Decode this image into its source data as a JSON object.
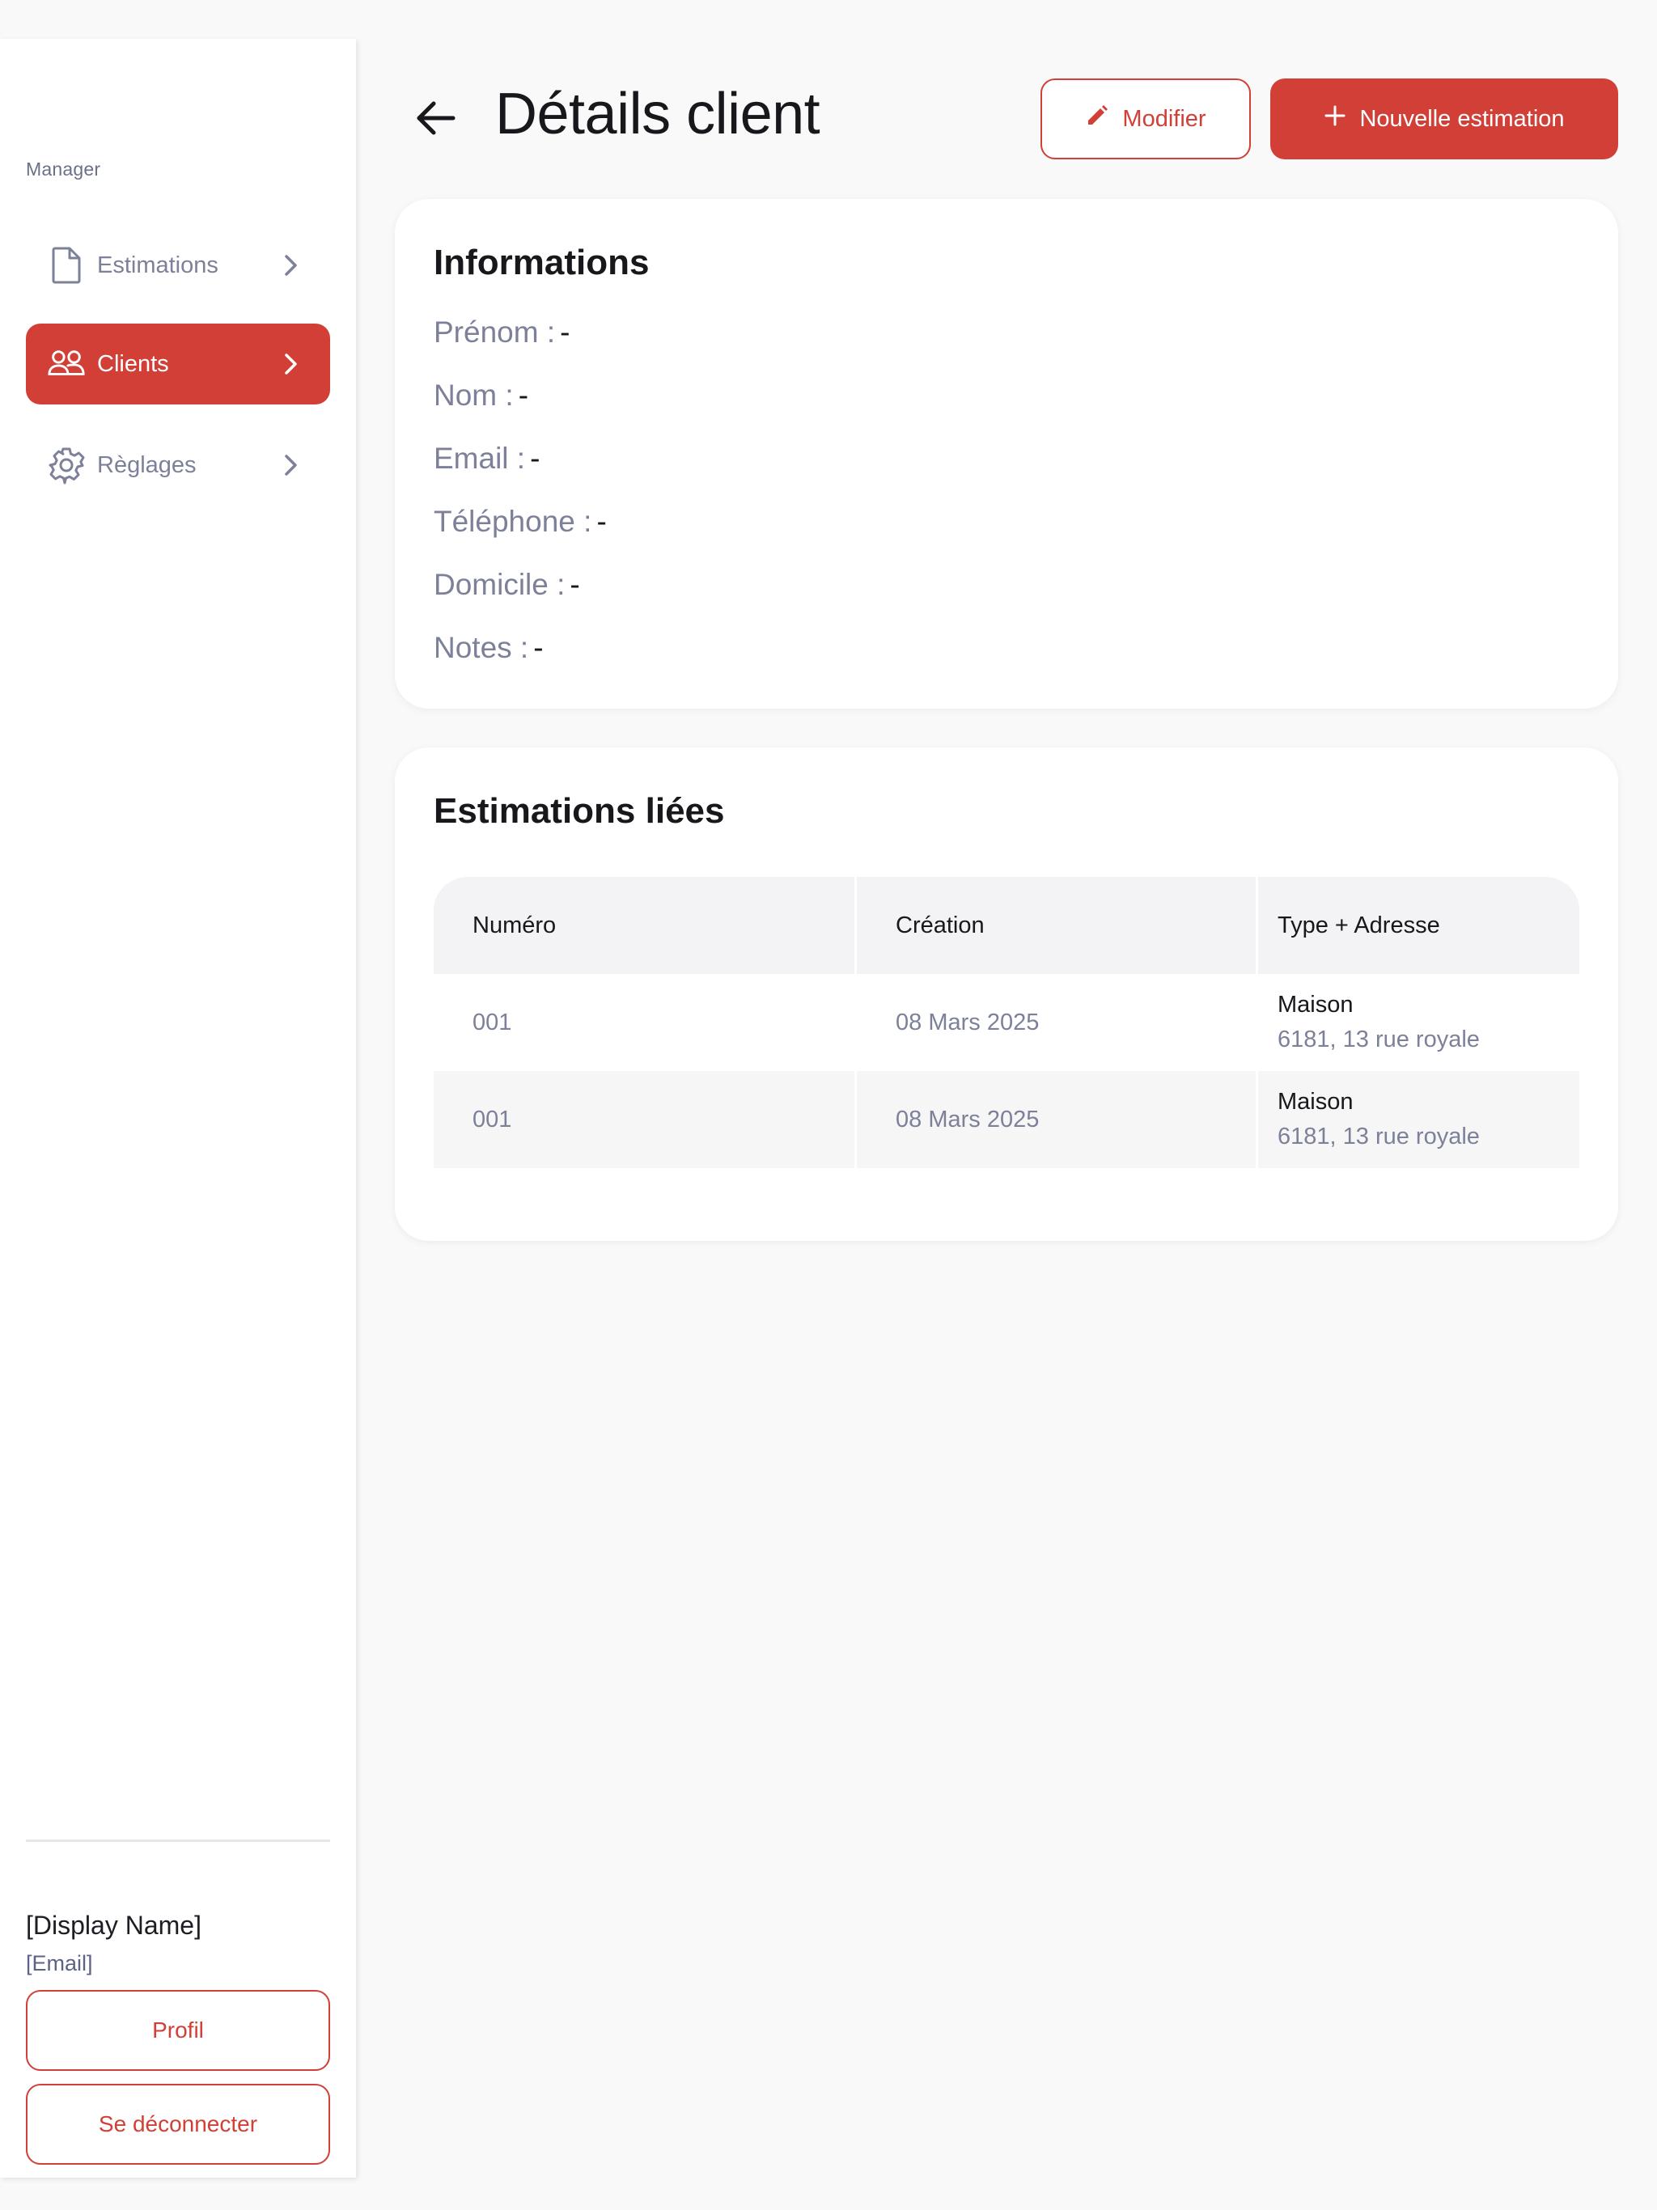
{
  "sidebar": {
    "brand": "Manager",
    "items": [
      {
        "label": "Estimations",
        "icon": "document-icon",
        "active": false
      },
      {
        "label": "Clients",
        "icon": "users-icon",
        "active": true
      },
      {
        "label": "Règlages",
        "icon": "gear-icon",
        "active": false
      }
    ],
    "user": {
      "display_name": "[Display Name]",
      "email": "[Email]"
    },
    "profile_button": "Profil",
    "logout_button": "Se déconnecter"
  },
  "header": {
    "title": "Détails client",
    "edit_button": "Modifier",
    "new_estimation_button": "Nouvelle estimation"
  },
  "informations": {
    "title": "Informations",
    "fields": [
      {
        "label": "Prénom :",
        "value": "-"
      },
      {
        "label": "Nom :",
        "value": "-"
      },
      {
        "label": "Email :",
        "value": "-"
      },
      {
        "label": "Téléphone :",
        "value": "-"
      },
      {
        "label": "Domicile :",
        "value": "-"
      },
      {
        "label": "Notes :",
        "value": "-"
      }
    ]
  },
  "estimations": {
    "title": "Estimations liées",
    "columns": [
      "Numéro",
      "Création",
      "Type + Adresse"
    ],
    "rows": [
      {
        "numero": "001",
        "creation": "08 Mars 2025",
        "type": "Maison",
        "adresse": "6181, 13 rue royale"
      },
      {
        "numero": "001",
        "creation": "08 Mars 2025",
        "type": "Maison",
        "adresse": "6181, 13 rue royale"
      }
    ]
  },
  "colors": {
    "accent": "#d13f37",
    "muted_text": "#7c8199",
    "background": "#f9f9f9"
  }
}
